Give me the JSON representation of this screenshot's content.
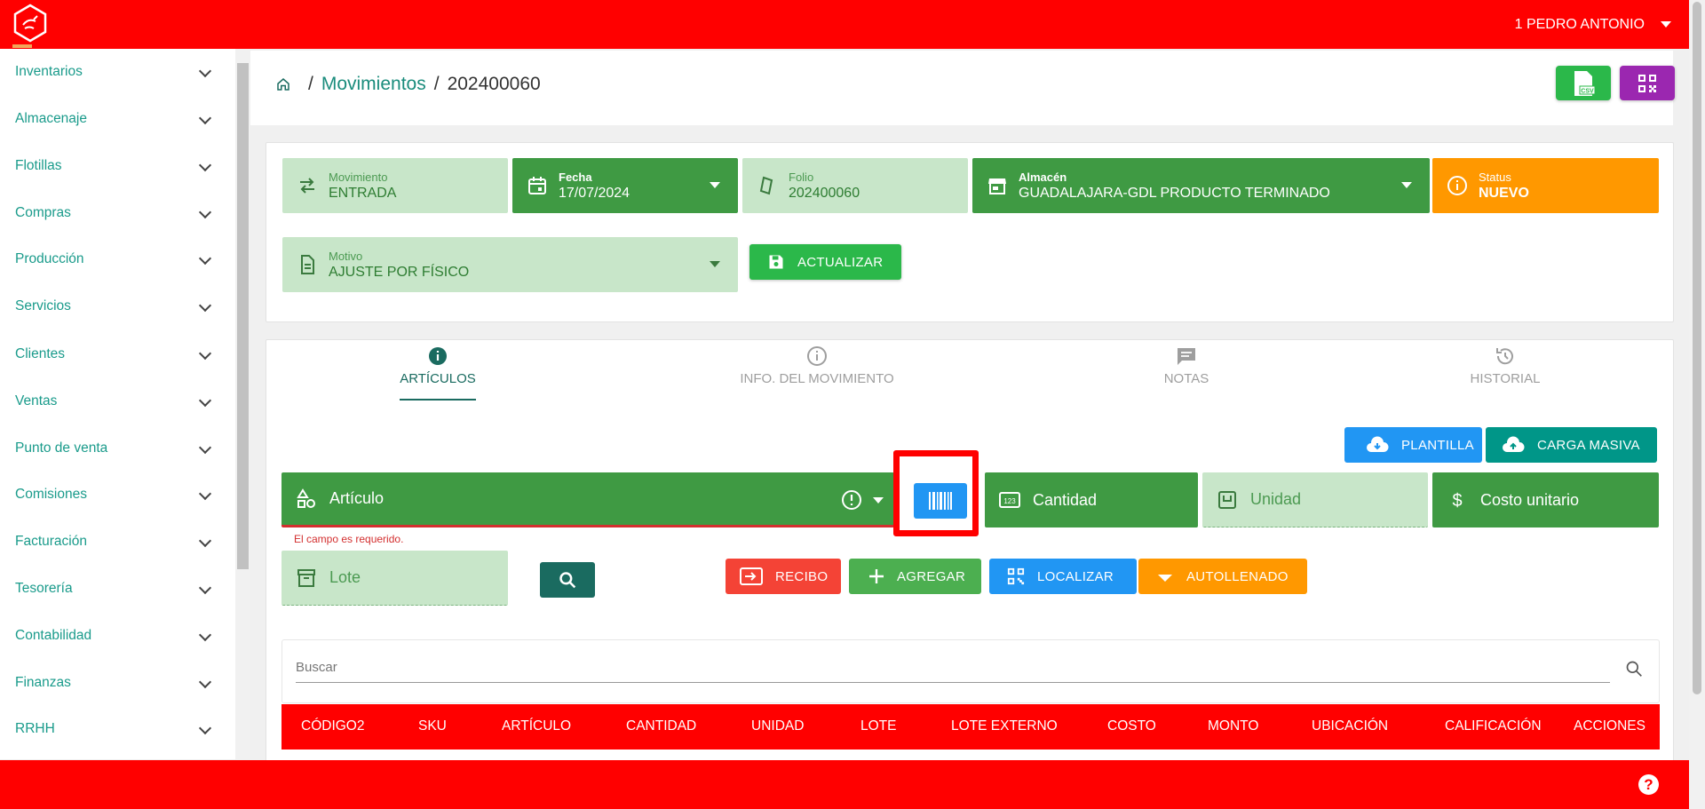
{
  "user": {
    "name": "1 PEDRO ANTONIO"
  },
  "sidebar": {
    "items": [
      {
        "label": "Inventarios"
      },
      {
        "label": "Almacenaje"
      },
      {
        "label": "Flotillas"
      },
      {
        "label": "Compras"
      },
      {
        "label": "Producción"
      },
      {
        "label": "Servicios"
      },
      {
        "label": "Clientes"
      },
      {
        "label": "Ventas"
      },
      {
        "label": "Punto de venta"
      },
      {
        "label": "Comisiones"
      },
      {
        "label": "Facturación"
      },
      {
        "label": "Tesorería"
      },
      {
        "label": "Contabilidad"
      },
      {
        "label": "Finanzas"
      },
      {
        "label": "RRHH"
      }
    ]
  },
  "breadcrumb": {
    "section": "Movimientos",
    "current": "202400060"
  },
  "header_buttons": {
    "csv_label": "CSV"
  },
  "form": {
    "movimiento": {
      "label": "Movimiento",
      "value": "ENTRADA"
    },
    "fecha": {
      "label": "Fecha",
      "value": "17/07/2024"
    },
    "folio": {
      "label": "Folio",
      "value": "202400060"
    },
    "almacen": {
      "label": "Almacén",
      "value": "GUADALAJARA-GDL PRODUCTO TERMINADO"
    },
    "status": {
      "label": "Status",
      "value": "NUEVO"
    },
    "motivo": {
      "label": "Motivo",
      "value": "AJUSTE POR FÍSICO"
    },
    "actualizar_label": "ACTUALIZAR"
  },
  "tabs": [
    {
      "label": "ARTÍCULOS",
      "active": true
    },
    {
      "label": "INFO. DEL MOVIMIENTO"
    },
    {
      "label": "NOTAS"
    },
    {
      "label": "HISTORIAL"
    }
  ],
  "items_panel": {
    "plantilla_label": "PLANTILLA",
    "carga_masiva_label": "CARGA MASIVA",
    "articulo_label": "Artículo",
    "articulo_error": "El campo es requerido.",
    "cantidad_label": "Cantidad",
    "unidad_label": "Unidad",
    "costo_label": "Costo unitario",
    "lote_label": "Lote",
    "recibo_label": "RECIBO",
    "agregar_label": "AGREGAR",
    "localizar_label": "LOCALIZAR",
    "autollenado_label": "AUTOLLENADO",
    "search_placeholder": "Buscar"
  },
  "table": {
    "columns": [
      "CÓDIGO2",
      "SKU",
      "ARTÍCULO",
      "CANTIDAD",
      "UNIDAD",
      "LOTE",
      "LOTE EXTERNO",
      "COSTO",
      "MONTO",
      "UBICACIÓN",
      "CALIFICACIÓN",
      "ACCIONES"
    ]
  },
  "colors": {
    "brand_red": "#ff0000",
    "green_dark": "#3f9a43",
    "green_light": "#c8e6c9",
    "status_orange": "#ff9800",
    "blue": "#2196f3",
    "teal": "#009688"
  }
}
